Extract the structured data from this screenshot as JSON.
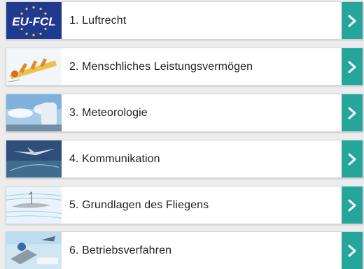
{
  "accent_color": "#26a69a",
  "topics": [
    {
      "label": "1. Luftrecht",
      "thumb_text": "EU-FCL",
      "icon": "eu-fcl-logo-icon"
    },
    {
      "label": "2. Menschliches Leistungsvermögen",
      "icon": "human-performance-thumbnail"
    },
    {
      "label": "3. Meteorologie",
      "icon": "meteorology-thumbnail"
    },
    {
      "label": "4. Kommunikation",
      "icon": "communication-thumbnail"
    },
    {
      "label": "5. Grundlagen des Fliegens",
      "icon": "principles-of-flight-thumbnail"
    },
    {
      "label": "6. Betriebsverfahren",
      "icon": "operational-procedures-thumbnail"
    }
  ]
}
